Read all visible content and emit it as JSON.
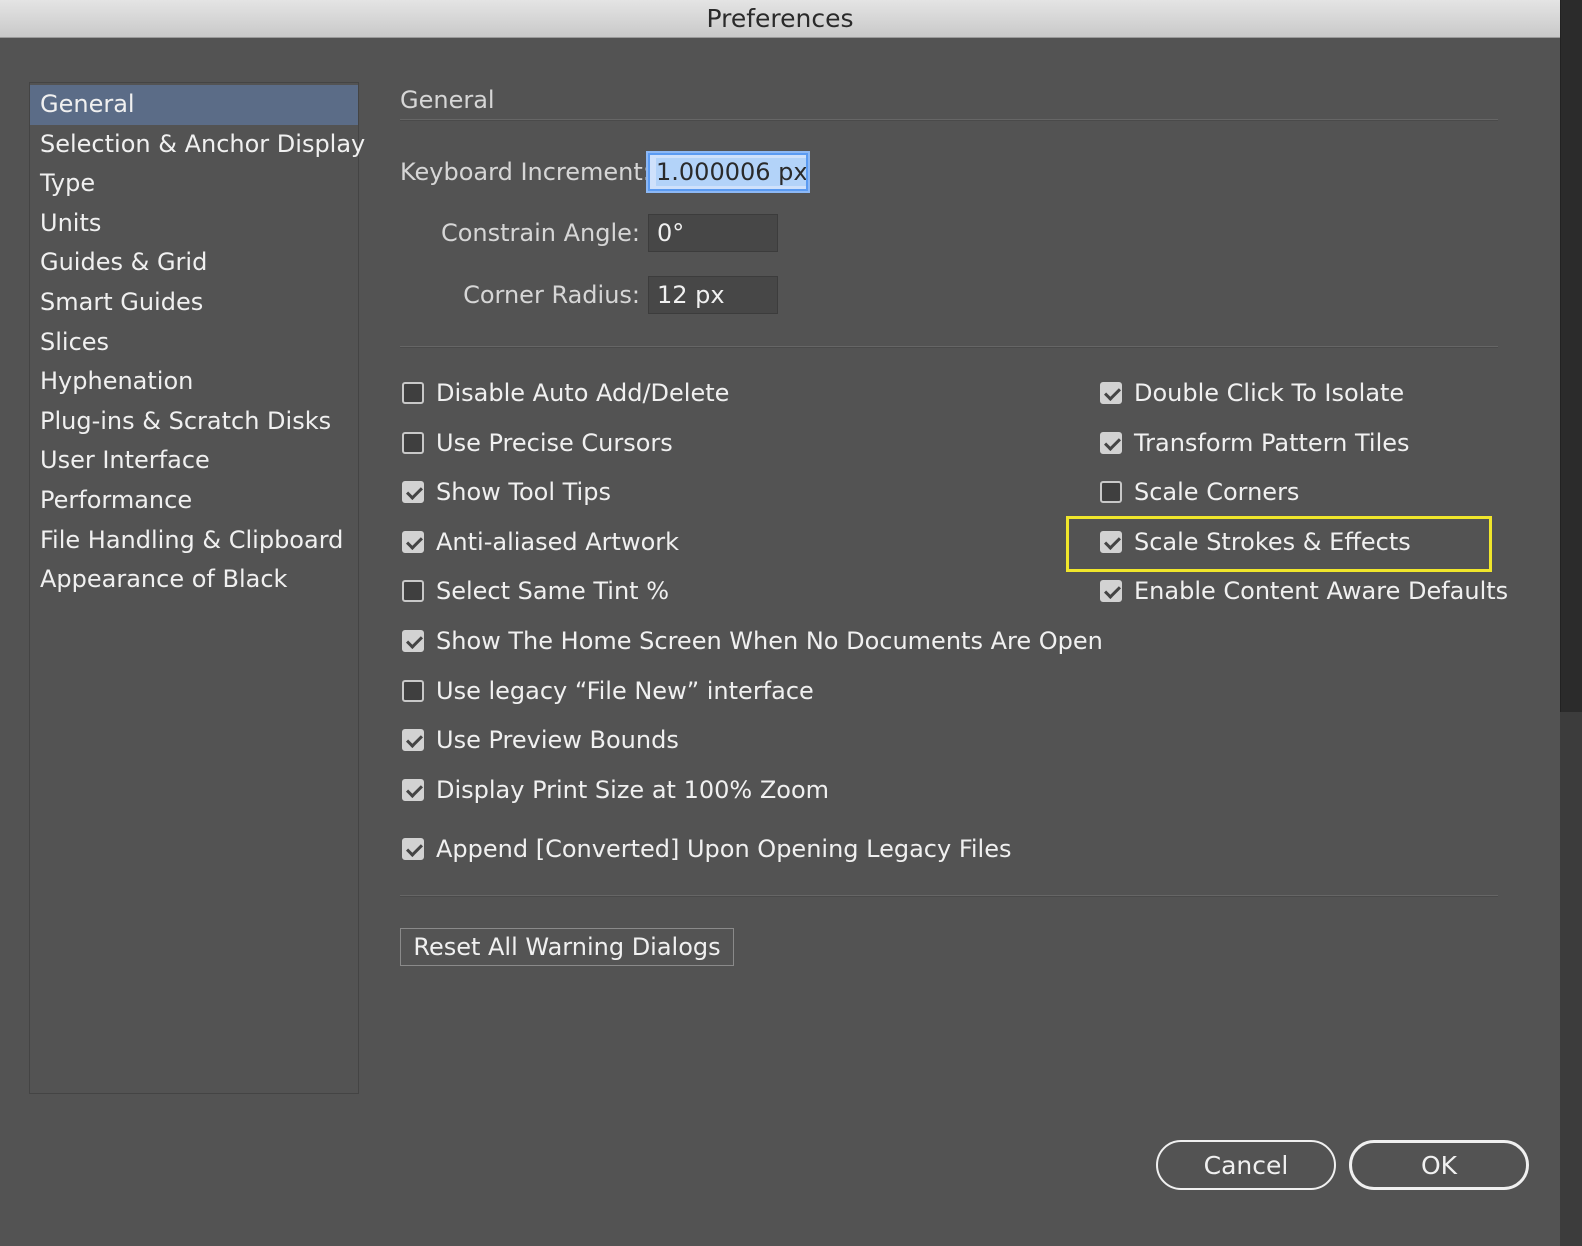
{
  "window": {
    "title": "Preferences"
  },
  "sidebar": {
    "items": [
      {
        "label": "General",
        "selected": true
      },
      {
        "label": "Selection & Anchor Display"
      },
      {
        "label": "Type"
      },
      {
        "label": "Units"
      },
      {
        "label": "Guides & Grid"
      },
      {
        "label": "Smart Guides"
      },
      {
        "label": "Slices"
      },
      {
        "label": "Hyphenation"
      },
      {
        "label": "Plug-ins & Scratch Disks"
      },
      {
        "label": "User Interface"
      },
      {
        "label": "Performance"
      },
      {
        "label": "File Handling & Clipboard"
      },
      {
        "label": "Appearance of Black"
      }
    ]
  },
  "main": {
    "section_title": "General",
    "fields": {
      "keyboard_increment": {
        "label": "Keyboard Increment:",
        "value": "1.000006 px"
      },
      "constrain_angle": {
        "label": "Constrain Angle:",
        "value": "0°"
      },
      "corner_radius": {
        "label": "Corner Radius:",
        "value": "12 px"
      }
    },
    "left_options": [
      {
        "label": "Disable Auto Add/Delete",
        "checked": false
      },
      {
        "label": "Use Precise Cursors",
        "checked": false
      },
      {
        "label": "Show Tool Tips",
        "checked": true
      },
      {
        "label": "Anti-aliased Artwork",
        "checked": true
      },
      {
        "label": "Select Same Tint %",
        "checked": false
      },
      {
        "label": "Show The Home Screen When No Documents Are Open",
        "checked": true
      },
      {
        "label": "Use legacy “File New” interface",
        "checked": false
      },
      {
        "label": "Use Preview Bounds",
        "checked": true
      },
      {
        "label": "Display Print Size at 100% Zoom",
        "checked": true
      },
      {
        "label": "Append [Converted] Upon Opening Legacy Files",
        "checked": true
      }
    ],
    "right_options": [
      {
        "label": "Double Click To Isolate",
        "checked": true
      },
      {
        "label": "Transform Pattern Tiles",
        "checked": true
      },
      {
        "label": "Scale Corners",
        "checked": false
      },
      {
        "label": "Scale Strokes & Effects",
        "checked": true
      },
      {
        "label": "Enable Content Aware Defaults",
        "checked": true
      }
    ],
    "reset_button": "Reset All Warning Dialogs"
  },
  "footer": {
    "cancel": "Cancel",
    "ok": "OK"
  },
  "colors": {
    "background": "#535353",
    "selected": "#5b6c87",
    "highlight": "#f0e62b",
    "focus": "#5b9bf2"
  }
}
